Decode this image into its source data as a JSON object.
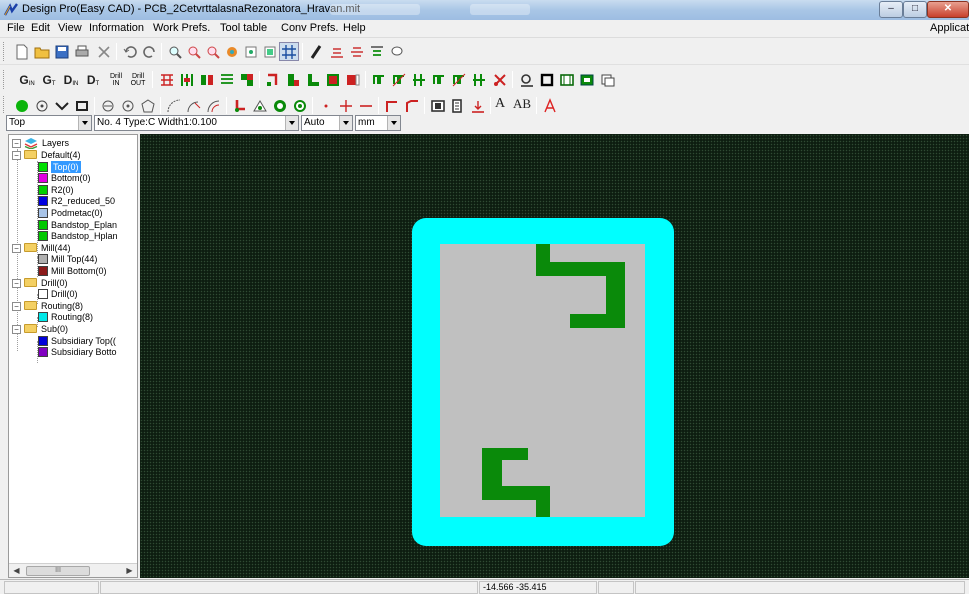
{
  "window": {
    "title": "Design Pro(Easy CAD) - PCB_2CetvrttalasnaRezonatora_Hravan.mit",
    "minimize_label": "–",
    "maximize_label": "□",
    "close_label": "✕"
  },
  "menubar": {
    "items": [
      "File",
      "Edit",
      "View",
      "Information",
      "Work Prefs.",
      "Tool table",
      "Conv Prefs.",
      "Help"
    ],
    "right_label": "Applicatio"
  },
  "toolbar2_text": {
    "g_in": "G",
    "g_in_sub": "IN",
    "g_t": "G",
    "g_t_sub": "T",
    "d_in": "D",
    "d_in_sub": "IN",
    "d_t": "D",
    "d_t_sub": "T",
    "drill_in": "Drill IN",
    "drill_out": "Drill OUT"
  },
  "toolbar3_text": {
    "text_a": "A",
    "text_ab": "AB"
  },
  "combos": {
    "layer": "Top",
    "tool": "No. 4 Type:C Width1:0.100",
    "mode": "Auto",
    "units": "mm"
  },
  "tree": {
    "root": "Layers",
    "groups": [
      {
        "label": "Default(4)",
        "items": [
          {
            "label": "Top(0)",
            "color": "#00e000",
            "selected": true
          },
          {
            "label": "Bottom(0)",
            "color": "#e000e0"
          },
          {
            "label": "R2(0)",
            "color": "#00d000"
          },
          {
            "label": "R2_reduced_50",
            "color": "#0000e0"
          },
          {
            "label": "Podmetac(0)",
            "color": "#a8c4e8"
          },
          {
            "label": "Bandstop_Eplan",
            "color": "#00c800"
          },
          {
            "label": "Bandstop_Hplan",
            "color": "#00c800"
          }
        ]
      },
      {
        "label": "Mill(44)",
        "items": [
          {
            "label": "Mill Top(44)",
            "color": "#b0b0b0"
          },
          {
            "label": "Mill Bottom(0)",
            "color": "#8b1a1a"
          }
        ]
      },
      {
        "label": "Drill(0)",
        "items": [
          {
            "label": "Drill(0)",
            "color": "#ffffff"
          }
        ]
      },
      {
        "label": "Routing(8)",
        "items": [
          {
            "label": "Routing(8)",
            "color": "#00e8e8"
          }
        ]
      },
      {
        "label": "Sub(0)",
        "items": [
          {
            "label": "Subsidiary Top((",
            "color": "#0000d8"
          },
          {
            "label": "Subsidiary Botto",
            "color": "#8000c0"
          }
        ]
      }
    ],
    "scroll_thumb": "III"
  },
  "status": {
    "coords": "-14.566 -35.415"
  },
  "colors": {
    "routing": "#00ffff",
    "board": "#c0c0c0",
    "copper": "#0a8a0a",
    "canvas_bg": "#0d1d10"
  }
}
